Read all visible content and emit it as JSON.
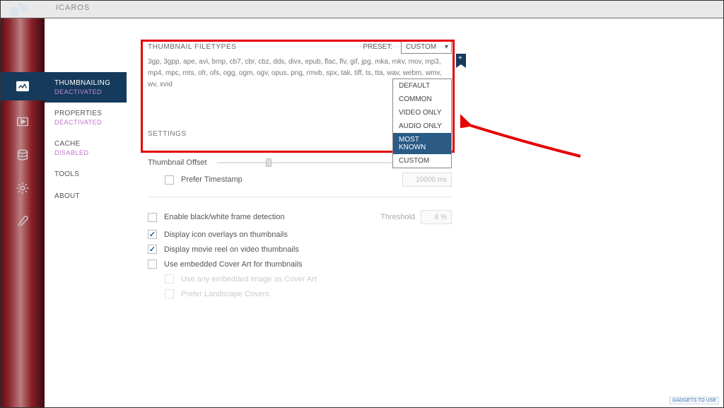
{
  "app": {
    "title": "ICAROS"
  },
  "sidebar": {
    "items": [
      {
        "label": "THUMBNAILING",
        "sub": "DEACTIVATED"
      },
      {
        "label": "PROPERTIES",
        "sub": "DEACTIVATED"
      },
      {
        "label": "CACHE",
        "sub": "DISABLED"
      },
      {
        "label": "TOOLS",
        "sub": ""
      },
      {
        "label": "ABOUT",
        "sub": ""
      }
    ]
  },
  "filetypes": {
    "header": "THUMBNAIL FILETYPES",
    "preset_label": "PRESET:",
    "preset_value": "CUSTOM",
    "list": "3gp, 3gpp, ape, avi, bmp, cb7, cbr, cbz, dds, divx, epub, flac, flv, gif, jpg, mka, mkv, mov, mp3, mp4, mpc, mts, ofr, ofs, ogg, ogm, ogv, opus, png, rmvb, spx, tak, tiff, ts, tta, wav, webm, wmv, wv, xvid",
    "options": [
      "DEFAULT",
      "COMMON",
      "VIDEO ONLY",
      "AUDIO ONLY",
      "MOST KNOWN",
      "CUSTOM"
    ],
    "highlighted": "MOST KNOWN"
  },
  "settings": {
    "header": "SETTINGS",
    "thumbnail_offset_label": "Thumbnail Offset",
    "thumbnail_offset_value": "25 %",
    "prefer_timestamp_label": "Prefer Timestamp",
    "prefer_timestamp_value": "10000 ms",
    "frame_detection_label": "Enable black/white frame detection",
    "threshold_label": "Threshold",
    "threshold_value": "8 %",
    "icon_overlays_label": "Display icon overlays on thumbnails",
    "movie_reel_label": "Display movie reel on video thumbnails",
    "cover_art_label": "Use embedded Cover Art for thumbnails",
    "any_image_label": "Use any embedded image as Cover Art",
    "landscape_label": "Prefer Landscape Covers"
  },
  "watermark": "GADGETS TO USE"
}
